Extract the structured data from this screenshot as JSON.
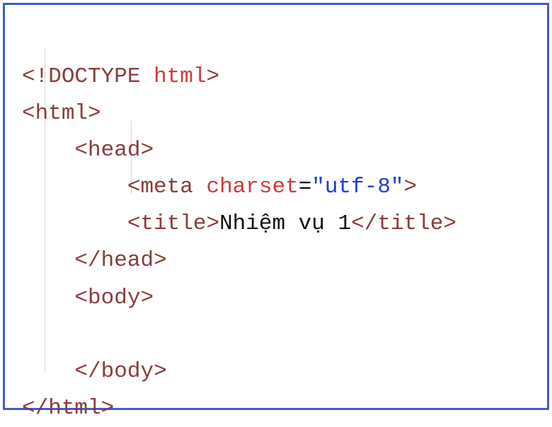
{
  "code": {
    "line1": {
      "open": "<!",
      "doctype": "DOCTYPE",
      "space": " ",
      "html_kw": "html",
      "close": ">"
    },
    "line2": {
      "open": "<",
      "tag": "html",
      "close": ">"
    },
    "line3": {
      "indent": "    ",
      "open": "<",
      "tag": "head",
      "close": ">"
    },
    "line4": {
      "indent": "        ",
      "open": "<",
      "tag": "meta",
      "space": " ",
      "attr": "charset",
      "equals": "=",
      "value": "\"utf-8\"",
      "close": ">"
    },
    "line5": {
      "indent": "        ",
      "open": "<",
      "tag_open": "title",
      "close1": ">",
      "text": "Nhiệm vụ 1",
      "open2": "</",
      "tag_close": "title",
      "close2": ">"
    },
    "line6": {
      "indent": "    ",
      "open": "</",
      "tag": "head",
      "close": ">"
    },
    "line7": {
      "indent": "    ",
      "open": "<",
      "tag": "body",
      "close": ">"
    },
    "line8": {
      "indent": "        "
    },
    "line9": {
      "indent": "    ",
      "open": "</",
      "tag": "body",
      "close": ">"
    },
    "line10": {
      "open": "</",
      "tag": "html",
      "close": ">"
    }
  }
}
